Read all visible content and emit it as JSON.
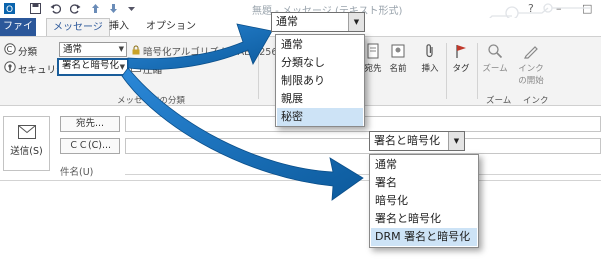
{
  "titlebar": {
    "title": "無題 - メッセージ (テキスト形式)"
  },
  "tabs": [
    {
      "label": "ファイル"
    },
    {
      "label": "メッセージ"
    },
    {
      "label": "挿入"
    },
    {
      "label": "オプション"
    }
  ],
  "ribbon": {
    "classification_label": "分類",
    "classification_value": "通常",
    "security_label": "セキュリティ",
    "security_value": "署名と暗号化",
    "algorithm_text": "暗号化アルゴリズム - AES 256 bits",
    "compress_label": "圧縮",
    "group_label": "メッセージの分類",
    "buttons": {
      "to": "宛先",
      "names": "名前",
      "insert": "挿入",
      "tags": "タグ",
      "zoom": "ズーム",
      "ink_start": "インクの開始",
      "zoom_group": "ズーム",
      "ink_group": "インク"
    }
  },
  "compose": {
    "send_label": "送信(S)",
    "to_button": "宛先...",
    "cc_button": "ＣＣ(C)...",
    "subject_label": "件名(U)"
  },
  "classification_popup": {
    "selected": "通常",
    "options": [
      "通常",
      "分類なし",
      "制限あり",
      "親展",
      "秘密"
    ],
    "highlighted_index": 4
  },
  "security_popup": {
    "selected": "署名と暗号化",
    "options": [
      "通常",
      "署名",
      "暗号化",
      "署名と暗号化",
      "DRM 署名と暗号化"
    ],
    "highlighted_index": 4
  },
  "colors": {
    "accent": "#2b579a",
    "arrow": "#1a6fb3",
    "highlight": "#cde3f6"
  }
}
